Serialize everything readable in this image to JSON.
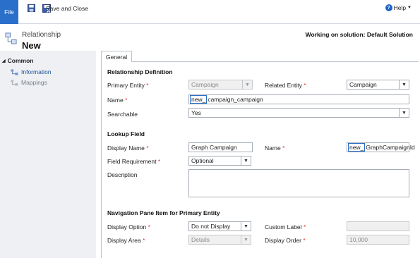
{
  "ribbon": {
    "file_label": "File",
    "save_close_label": "Save and Close",
    "help_label": "Help"
  },
  "header": {
    "entity_type": "Relationship",
    "title": "New",
    "solution": "Working on solution: Default Solution"
  },
  "nav": {
    "section": "Common",
    "items": [
      {
        "label": "Information"
      },
      {
        "label": "Mappings"
      }
    ]
  },
  "tab": {
    "label": "General"
  },
  "relationship_definition": {
    "title": "Relationship Definition",
    "primary_entity_label": "Primary Entity",
    "primary_entity_value": "Campaign",
    "related_entity_label": "Related Entity",
    "related_entity_value": "Campaign",
    "name_label": "Name",
    "name_prefix": "new_",
    "name_value": "campaign_campaign",
    "searchable_label": "Searchable",
    "searchable_value": "Yes"
  },
  "lookup_field": {
    "title": "Lookup Field",
    "display_name_label": "Display Name",
    "display_name_value": "Graph Campaign",
    "name_label": "Name",
    "name_prefix": "new_",
    "name_value": "GraphCampaignId",
    "field_requirement_label": "Field Requirement",
    "field_requirement_value": "Optional",
    "description_label": "Description"
  },
  "navigation_pane": {
    "title": "Navigation Pane Item for Primary Entity",
    "display_option_label": "Display Option",
    "display_option_value": "Do not Display",
    "custom_label_label": "Custom Label",
    "display_area_label": "Display Area",
    "display_area_value": "Details",
    "display_order_label": "Display Order",
    "display_order_value": "10,000"
  },
  "colors": {
    "file_button": "#2a6fc9",
    "required_star": "#e03030",
    "nav_background": "#eef0f3"
  }
}
